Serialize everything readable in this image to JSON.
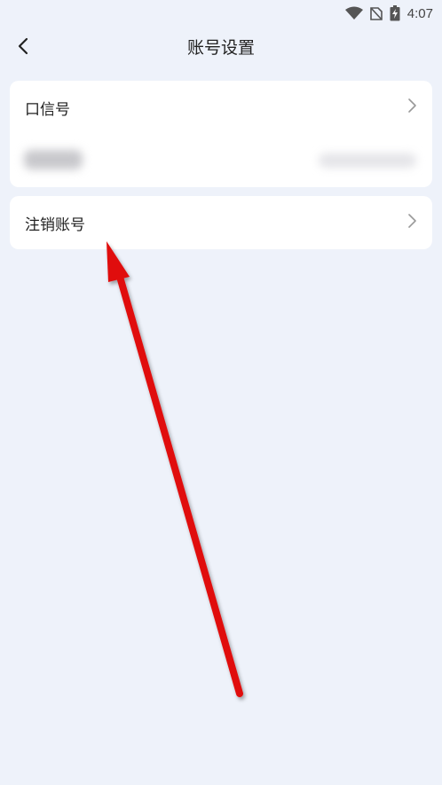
{
  "status_bar": {
    "time": "4:07",
    "icons": [
      "wifi-icon",
      "no-sim-icon",
      "battery-charging-icon"
    ]
  },
  "header": {
    "title": "账号设置",
    "back_icon": "chevron-left-icon"
  },
  "settings": {
    "items": [
      {
        "label": "口信号",
        "icon": "chevron-right-icon"
      },
      {
        "label": "注销账号",
        "icon": "chevron-right-icon"
      }
    ]
  },
  "overlay": {
    "arrow_color": "#e01010"
  }
}
